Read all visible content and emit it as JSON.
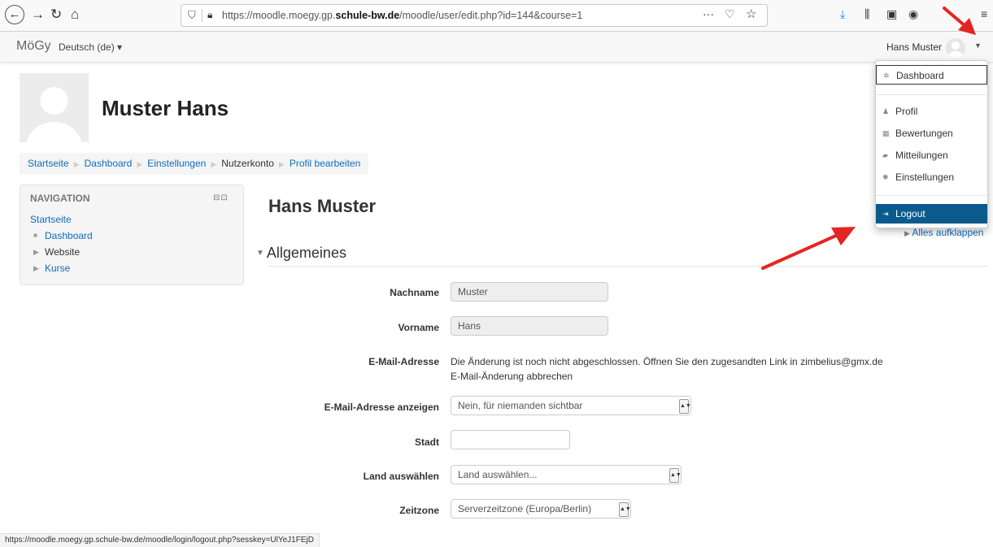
{
  "browser": {
    "url_prefix": "https://moodle.moegy.gp.",
    "url_domain": "schule-bw.de",
    "url_suffix": "/moodle/user/edit.php?id=144&course=1",
    "status_url": "https://moodle.moegy.gp.schule-bw.de/moodle/login/logout.php?sesskey=UlYeJ1FEjD"
  },
  "navbar": {
    "brand": "MöGy",
    "language": "Deutsch (de) ▾",
    "username": "Hans Muster"
  },
  "header": {
    "fullname": "Muster Hans"
  },
  "breadcrumb": [
    "Startseite",
    "Dashboard",
    "Einstellungen",
    "Nutzerkonto",
    "Profil bearbeiten"
  ],
  "navigation_block": {
    "title": "NAVIGATION",
    "items": [
      {
        "label": "Startseite"
      },
      {
        "label": "Dashboard"
      },
      {
        "label": "Website"
      },
      {
        "label": "Kurse"
      }
    ]
  },
  "main": {
    "page_title": "Hans Muster",
    "section": "Allgemeines",
    "expand_all": "Alles aufklappen",
    "fields": {
      "nachname_label": "Nachname",
      "nachname_value": "Muster",
      "vorname_label": "Vorname",
      "vorname_value": "Hans",
      "email_label": "E-Mail-Adresse",
      "email_notice": "Die Änderung ist noch nicht abgeschlossen. Öffnen Sie den zugesandten Link in zimbelius@gmx.de",
      "email_cancel": "E-Mail-Änderung abbrechen",
      "email_display_label": "E-Mail-Adresse anzeigen",
      "email_display_value": "Nein, für niemanden sichtbar",
      "stadt_label": "Stadt",
      "stadt_value": "",
      "land_label": "Land auswählen",
      "land_value": "Land auswählen...",
      "zeitzone_label": "Zeitzone",
      "zeitzone_value": "Serverzeitzone (Europa/Berlin)"
    }
  },
  "user_menu": {
    "items": [
      "Dashboard",
      "Profil",
      "Bewertungen",
      "Mitteilungen",
      "Einstellungen",
      "Logout"
    ]
  },
  "colors": {
    "link": "#0f6cbf",
    "logout_highlight": "#0a5a8c",
    "annotation_arrow": "#e52521"
  }
}
